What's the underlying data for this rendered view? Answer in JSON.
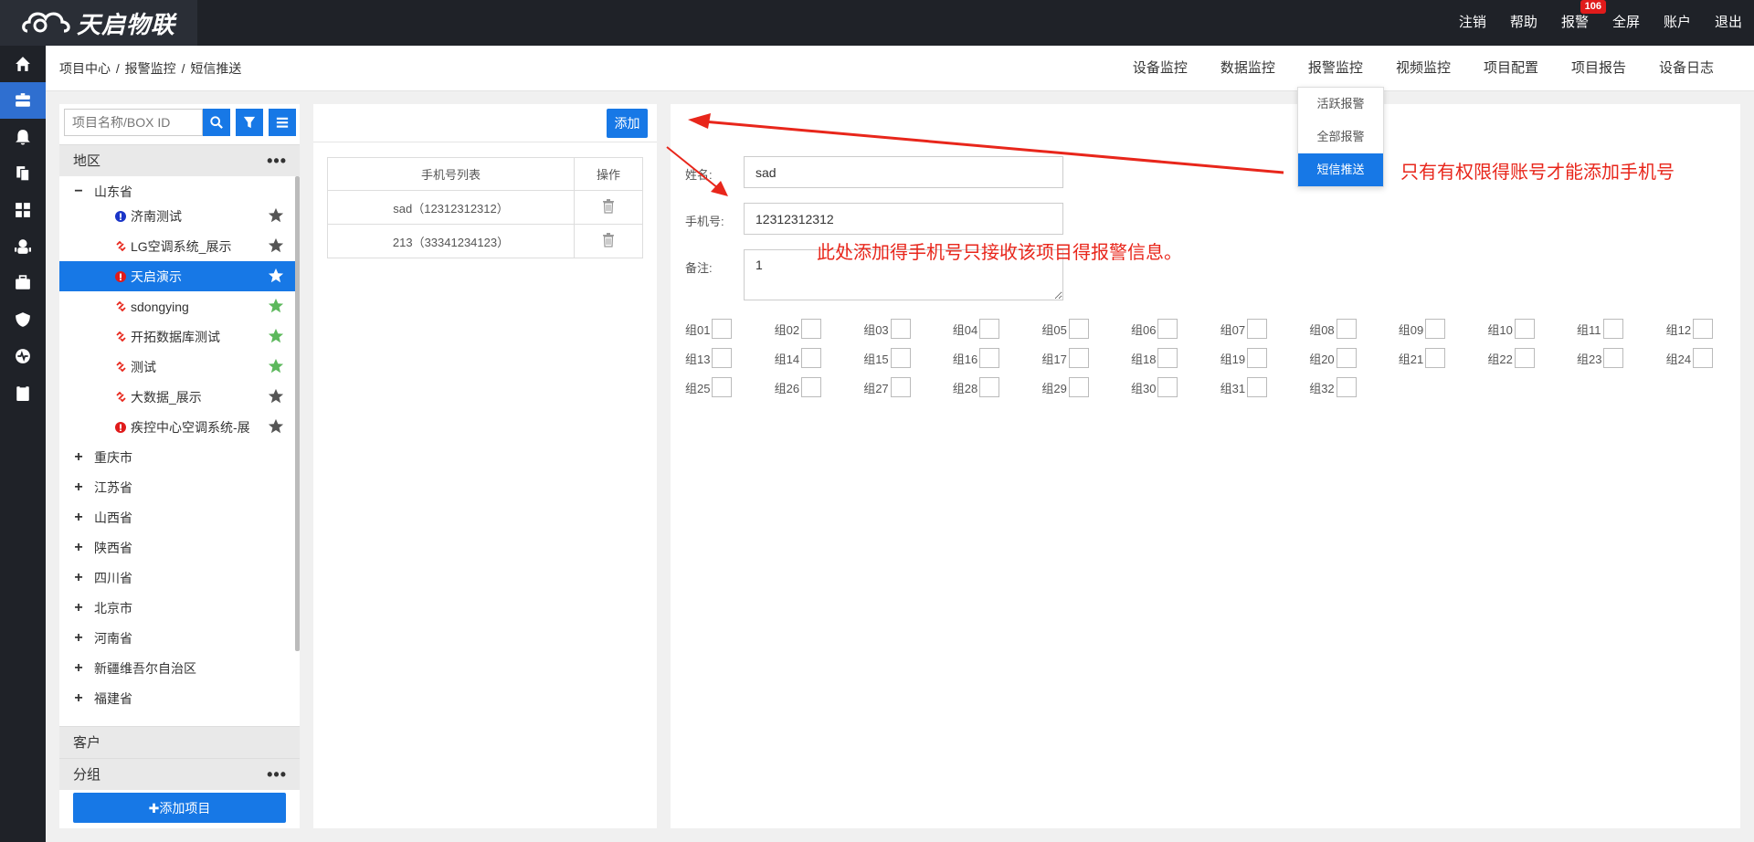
{
  "app": {
    "brand": "天启物联"
  },
  "topnav": {
    "items": [
      "注销",
      "帮助",
      "报警",
      "全屏",
      "账户",
      "退出"
    ],
    "alarm_badge": "106"
  },
  "breadcrumb": {
    "items": [
      "项目中心",
      "报警监控",
      "短信推送"
    ],
    "sep": "/"
  },
  "tabs": [
    "设备监控",
    "数据监控",
    "报警监控",
    "视频监控",
    "项目配置",
    "项目报告",
    "设备日志"
  ],
  "alarm_menu": {
    "items": [
      "活跃报警",
      "全部报警",
      "短信推送"
    ],
    "selected": "短信推送"
  },
  "left": {
    "search_placeholder": "项目名称/BOX ID",
    "region_header": "地区",
    "customer_header": "客户",
    "group_header": "分组",
    "add_project": "✚添加项目",
    "expanded_region": "山东省",
    "projects": [
      {
        "label": "济南测试",
        "status": "info",
        "starred": false
      },
      {
        "label": "LG空调系统_展示",
        "status": "offline",
        "starred": false
      },
      {
        "label": "天启演示",
        "status": "alarm",
        "starred": false,
        "selected": true
      },
      {
        "label": "sdongying",
        "status": "offline",
        "starred": true
      },
      {
        "label": "开拓数据库测试",
        "status": "offline",
        "starred": true
      },
      {
        "label": "测试",
        "status": "offline",
        "starred": true
      },
      {
        "label": "大数据_展示",
        "status": "offline",
        "starred": false
      },
      {
        "label": "疾控中心空调系统-展",
        "status": "alarm",
        "starred": false
      }
    ],
    "regions": [
      "重庆市",
      "江苏省",
      "山西省",
      "陕西省",
      "四川省",
      "北京市",
      "河南省",
      "新疆维吾尔自治区",
      "福建省"
    ]
  },
  "phones": {
    "add_button": "添加",
    "col_list": "手机号列表",
    "col_action": "操作",
    "rows": [
      "sad（12312312312）",
      "213（33341234123）"
    ]
  },
  "form": {
    "name_label": "姓名:",
    "name_value": "sad",
    "phone_label": "手机号:",
    "phone_value": "12312312312",
    "note_label": "备注:",
    "note_value": "1",
    "groups": [
      "组01",
      "组02",
      "组03",
      "组04",
      "组05",
      "组06",
      "组07",
      "组08",
      "组09",
      "组10",
      "组11",
      "组12",
      "组13",
      "组14",
      "组15",
      "组16",
      "组17",
      "组18",
      "组19",
      "组20",
      "组21",
      "组22",
      "组23",
      "组24",
      "组25",
      "组26",
      "组27",
      "组28",
      "组29",
      "组30",
      "组31",
      "组32"
    ]
  },
  "annotations": {
    "a1": "只有有权限得账号才能添加手机号",
    "a2": "此处添加得手机号只接收该项目得报警信息。"
  },
  "colors": {
    "accent": "#1778e6",
    "dark": "#1f2228",
    "annot": "#e8261b",
    "star_on": "#5cb85c",
    "star_off": "#555555"
  }
}
